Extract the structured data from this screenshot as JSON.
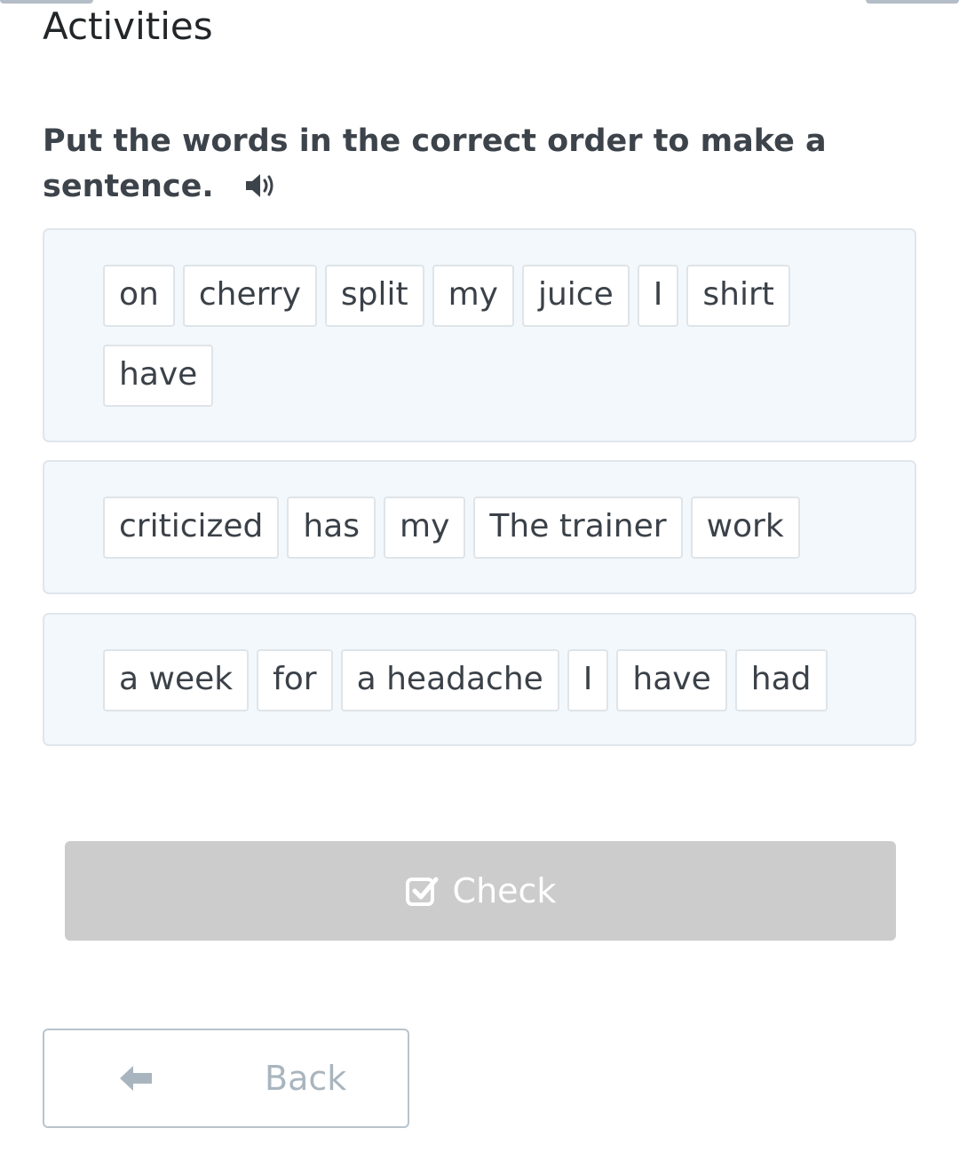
{
  "header": {
    "title": "Activities"
  },
  "instruction": {
    "text": "Put the words in the correct order to make a sentence.",
    "audio_icon": "speaker-icon"
  },
  "sentences": [
    {
      "words": [
        "on",
        "cherry",
        "split",
        "my",
        "juice",
        "I",
        "shirt",
        "have"
      ]
    },
    {
      "words": [
        "criticized",
        "has",
        "my",
        "The trainer",
        "work"
      ]
    },
    {
      "words": [
        "a week",
        "for",
        "a headache",
        "I",
        "have",
        "had"
      ]
    }
  ],
  "buttons": {
    "check_label": "Check",
    "check_icon": "checkbox-icon",
    "back_label": "Back",
    "back_icon": "arrow-left-icon"
  },
  "colors": {
    "check_button_bg": "#cccccc",
    "sentence_box_bg": "#f3f8fc",
    "text": "#3b4148"
  }
}
